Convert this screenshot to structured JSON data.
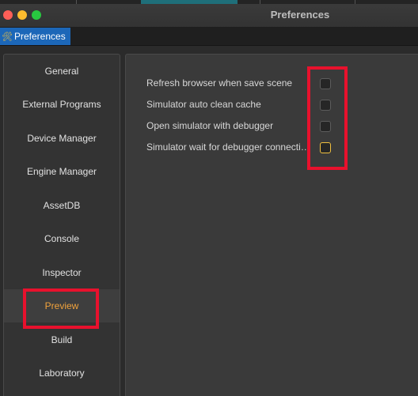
{
  "window": {
    "title": "Preferences",
    "traffic_lights": {
      "close": "#fe5f57",
      "minimize": "#febc2e",
      "zoom": "#28c840"
    }
  },
  "tab": {
    "label": "Preferences",
    "icon": "tools-icon",
    "color": "#1c67b8"
  },
  "sidebar": {
    "items": [
      {
        "label": "General"
      },
      {
        "label": "External Programs"
      },
      {
        "label": "Device Manager"
      },
      {
        "label": "Engine Manager"
      },
      {
        "label": "AssetDB"
      },
      {
        "label": "Console"
      },
      {
        "label": "Inspector"
      },
      {
        "label": "Preview",
        "active": true
      },
      {
        "label": "Build"
      },
      {
        "label": "Laboratory"
      }
    ],
    "active_color": "#f0a23c"
  },
  "preview": {
    "options": [
      {
        "label": "Refresh browser when save scene",
        "checked": false
      },
      {
        "label": "Simulator auto clean cache",
        "checked": false
      },
      {
        "label": "Open simulator with debugger",
        "checked": false
      },
      {
        "label": "Simulator wait for debugger connecti…",
        "checked": false,
        "focused": true
      }
    ]
  },
  "highlight_color": "#e8112d"
}
